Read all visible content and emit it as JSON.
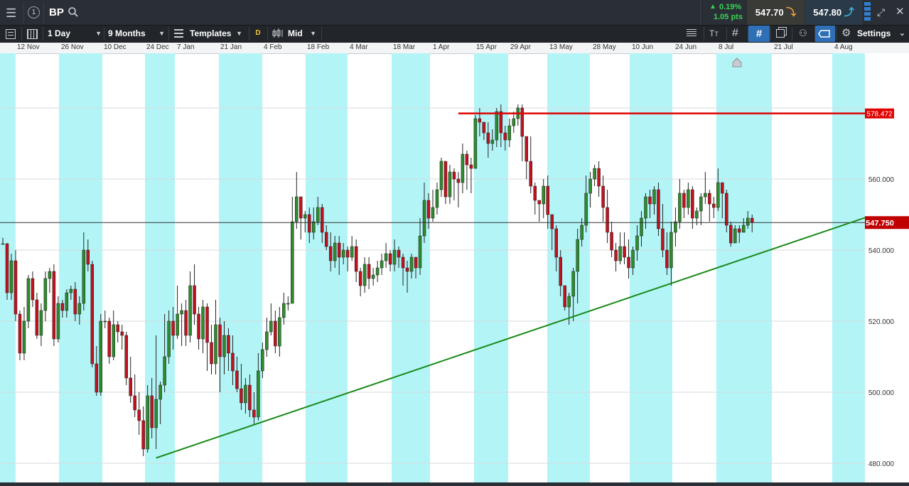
{
  "header": {
    "symbol": "BP",
    "change_pct": "0.19%",
    "change_pts": "1.05 pts",
    "sell_price": "547.70",
    "buy_price": "547.80"
  },
  "toolbar": {
    "interval": "1 Day",
    "range": "9 Months",
    "templates_label": "Templates",
    "d_badge": "D",
    "price_type": "Mid",
    "settings_label": "Settings"
  },
  "colors": {
    "up": "#2e8b2e",
    "down": "#c1121f",
    "band": "#b3f5f7",
    "trendline": "#1a8a1a",
    "resistance": "#e00000",
    "current_price_tag": "#c00000",
    "bg": "#ffffff"
  },
  "chart_data": {
    "type": "candlestick",
    "x_ticks": [
      "12 Nov",
      "26 Nov",
      "10 Dec",
      "24 Dec",
      "7 Jan",
      "21 Jan",
      "4 Feb",
      "18 Feb",
      "4 Mar",
      "18 Mar",
      "1 Apr",
      "15 Apr",
      "29 Apr",
      "13 May",
      "28 May",
      "10 Jun",
      "24 Jun",
      "8 Jul",
      "21 Jul",
      "4 Aug"
    ],
    "y_ticks": [
      "480.000",
      "500.000",
      "520.000",
      "540.000",
      "560.000"
    ],
    "y_range": [
      478,
      600
    ],
    "current_price": "547.750",
    "resistance_level": "578.472",
    "resistance": {
      "value": 578.472,
      "start_index": 107
    },
    "trendline": {
      "start_index": 36,
      "start_value": 481.5,
      "end_index": 217,
      "end_value": 555
    },
    "candles": [
      [
        541.8,
        541.8,
        543.5,
        541.8
      ],
      [
        541.8,
        528,
        542,
        526
      ],
      [
        528,
        537,
        539,
        526
      ],
      [
        537,
        522,
        540,
        520
      ],
      [
        522,
        511,
        523,
        509
      ],
      [
        511,
        520,
        524,
        509
      ],
      [
        520,
        532,
        533,
        518
      ],
      [
        532,
        526,
        534,
        524
      ],
      [
        526,
        516,
        528,
        515
      ],
      [
        516,
        523,
        525,
        513
      ],
      [
        523,
        532,
        534,
        520
      ],
      [
        532,
        534,
        535,
        528
      ],
      [
        534,
        515,
        536,
        513
      ],
      [
        515,
        525,
        527,
        514
      ],
      [
        525,
        523,
        526,
        521
      ],
      [
        523,
        528,
        529,
        521
      ],
      [
        528,
        529,
        530,
        526
      ],
      [
        529,
        522,
        531,
        520
      ],
      [
        522,
        525,
        527,
        519
      ],
      [
        525,
        540,
        545,
        523
      ],
      [
        540,
        536,
        543,
        534
      ],
      [
        536,
        508,
        537,
        507
      ],
      [
        508,
        500,
        513,
        499
      ],
      [
        500,
        520,
        522,
        499
      ],
      [
        520,
        520,
        523,
        518
      ],
      [
        520,
        510,
        521,
        508
      ],
      [
        510,
        519,
        523,
        509
      ],
      [
        519,
        517,
        520,
        514
      ],
      [
        517,
        516,
        519,
        512
      ],
      [
        516,
        504,
        517,
        502
      ],
      [
        504,
        499,
        510,
        497
      ],
      [
        499,
        495,
        505,
        493
      ],
      [
        495,
        492,
        500,
        488
      ],
      [
        492,
        484,
        496,
        482
      ],
      [
        484,
        499,
        502,
        483
      ],
      [
        499,
        490,
        504,
        487
      ],
      [
        490,
        498,
        516,
        484
      ],
      [
        498,
        502,
        503,
        491
      ],
      [
        502,
        510,
        522,
        500
      ],
      [
        510,
        520,
        523,
        508
      ],
      [
        520,
        516,
        524,
        512
      ],
      [
        516,
        522,
        530,
        515
      ],
      [
        522,
        523,
        525,
        513
      ],
      [
        523,
        516,
        526,
        513
      ],
      [
        516,
        530,
        534,
        514
      ],
      [
        530,
        522,
        536,
        519
      ],
      [
        522,
        515,
        524,
        512
      ],
      [
        515,
        524,
        526,
        511
      ],
      [
        524,
        514,
        525,
        506
      ],
      [
        514,
        508,
        519,
        505
      ],
      [
        508,
        519,
        526,
        505
      ],
      [
        519,
        510,
        521,
        500
      ],
      [
        510,
        516,
        520,
        505
      ],
      [
        516,
        511,
        518,
        506
      ],
      [
        511,
        506,
        516,
        502
      ],
      [
        506,
        501,
        510,
        500
      ],
      [
        501,
        497,
        508,
        495
      ],
      [
        497,
        502,
        504,
        494
      ],
      [
        502,
        495,
        505,
        493
      ],
      [
        495,
        493,
        500,
        491
      ],
      [
        493,
        506,
        511,
        492
      ],
      [
        506,
        512,
        514,
        504
      ],
      [
        512,
        517,
        521,
        510
      ],
      [
        517,
        520,
        525,
        516
      ],
      [
        520,
        513,
        523,
        511
      ],
      [
        513,
        521,
        524,
        510
      ],
      [
        521,
        525,
        528,
        519
      ],
      [
        525,
        525,
        527,
        523
      ],
      [
        525,
        548,
        555,
        537
      ],
      [
        548,
        555,
        562,
        546
      ],
      [
        555,
        549,
        554,
        543
      ],
      [
        549,
        550,
        551,
        545
      ],
      [
        550,
        545,
        552,
        542
      ],
      [
        545,
        548,
        552,
        543
      ],
      [
        548,
        552,
        555,
        547
      ],
      [
        552,
        545,
        553,
        542
      ],
      [
        545,
        541,
        547,
        540
      ],
      [
        541,
        537,
        545,
        534
      ],
      [
        537,
        542,
        544,
        535
      ],
      [
        542,
        538,
        544,
        533
      ],
      [
        538,
        540,
        542,
        536
      ],
      [
        540,
        538,
        541,
        534
      ],
      [
        538,
        541,
        544,
        537
      ],
      [
        541,
        534,
        543,
        531
      ],
      [
        534,
        530,
        535,
        527
      ],
      [
        530,
        536,
        538,
        528
      ],
      [
        536,
        532,
        538,
        529
      ],
      [
        532,
        533,
        535,
        530
      ],
      [
        533,
        535,
        537,
        531
      ],
      [
        535,
        537,
        539,
        533
      ],
      [
        537,
        539,
        542,
        535
      ],
      [
        539,
        536,
        540,
        534
      ],
      [
        536,
        540,
        543,
        534
      ],
      [
        540,
        538,
        541,
        535
      ],
      [
        538,
        535,
        539,
        530
      ],
      [
        535,
        534,
        537,
        528
      ],
      [
        534,
        538,
        539,
        532
      ],
      [
        538,
        535,
        538,
        532
      ],
      [
        535,
        544,
        549,
        533
      ],
      [
        544,
        554,
        559,
        542
      ],
      [
        554,
        549,
        556,
        546
      ],
      [
        549,
        552,
        557,
        548
      ],
      [
        552,
        557,
        559,
        550
      ],
      [
        557,
        565,
        566,
        555
      ],
      [
        565,
        555,
        564,
        553
      ],
      [
        555,
        562,
        564,
        553
      ],
      [
        562,
        560,
        563,
        554
      ],
      [
        560,
        559,
        562,
        552
      ],
      [
        559,
        567,
        570,
        556
      ],
      [
        567,
        564,
        568,
        557
      ],
      [
        564,
        563,
        566,
        556
      ],
      [
        563,
        577,
        578,
        570
      ],
      [
        577,
        576,
        580,
        572
      ],
      [
        576,
        573,
        576,
        571
      ],
      [
        573,
        570,
        576,
        566
      ],
      [
        570,
        571,
        574,
        568
      ],
      [
        571,
        579,
        580,
        569
      ],
      [
        579,
        573,
        581,
        569
      ],
      [
        573,
        571,
        575,
        568
      ],
      [
        571,
        575,
        577,
        569
      ],
      [
        575,
        577,
        579,
        573
      ],
      [
        577,
        580,
        581,
        575
      ],
      [
        580,
        572,
        581,
        565
      ],
      [
        572,
        565,
        570,
        560
      ],
      [
        565,
        558,
        572,
        556
      ],
      [
        558,
        554,
        559,
        550
      ],
      [
        554,
        553,
        554,
        548
      ],
      [
        553,
        558,
        560,
        549
      ],
      [
        558,
        550,
        561,
        546
      ],
      [
        550,
        546,
        550,
        540
      ],
      [
        546,
        538,
        547,
        534
      ],
      [
        538,
        530,
        540,
        527
      ],
      [
        530,
        524,
        529,
        523
      ],
      [
        524,
        527,
        528,
        519
      ],
      [
        527,
        534,
        535,
        520
      ],
      [
        534,
        543,
        546,
        525
      ],
      [
        543,
        547,
        549,
        541
      ],
      [
        547,
        556,
        561,
        545
      ],
      [
        556,
        560,
        562,
        552
      ],
      [
        560,
        563,
        564,
        558
      ],
      [
        563,
        558,
        565,
        555
      ],
      [
        558,
        552,
        561,
        548
      ],
      [
        552,
        545,
        557,
        542
      ],
      [
        545,
        540,
        548,
        538
      ],
      [
        540,
        537,
        542,
        534
      ],
      [
        537,
        541,
        545,
        536
      ],
      [
        541,
        538,
        545,
        536
      ],
      [
        538,
        535,
        543,
        532
      ],
      [
        535,
        540,
        541,
        533
      ],
      [
        540,
        544,
        547,
        537
      ],
      [
        544,
        549,
        551,
        541
      ],
      [
        549,
        555,
        556,
        546
      ],
      [
        555,
        553,
        557,
        549
      ],
      [
        553,
        557,
        558,
        550
      ],
      [
        557,
        546,
        559,
        544
      ],
      [
        546,
        540,
        553,
        538
      ],
      [
        540,
        535,
        545,
        533
      ],
      [
        535,
        545,
        548,
        530
      ],
      [
        545,
        548,
        552,
        541
      ],
      [
        548,
        556,
        560,
        546
      ],
      [
        556,
        552,
        557,
        549
      ],
      [
        552,
        557,
        559,
        550
      ],
      [
        557,
        549,
        558,
        546
      ],
      [
        549,
        551,
        552,
        547
      ],
      [
        551,
        555,
        556,
        547
      ],
      [
        555,
        556,
        562,
        553
      ],
      [
        556,
        553,
        557,
        548
      ],
      [
        553,
        552,
        555,
        549
      ],
      [
        552,
        559,
        563,
        551
      ],
      [
        559,
        556,
        559,
        549
      ],
      [
        556,
        547,
        557,
        545
      ],
      [
        547,
        542,
        548,
        541
      ],
      [
        542,
        546,
        547,
        543
      ],
      [
        546,
        545,
        547,
        542
      ],
      [
        545,
        547,
        549,
        545
      ],
      [
        547,
        549,
        551,
        546
      ],
      [
        549,
        547.75,
        550,
        545
      ]
    ]
  }
}
